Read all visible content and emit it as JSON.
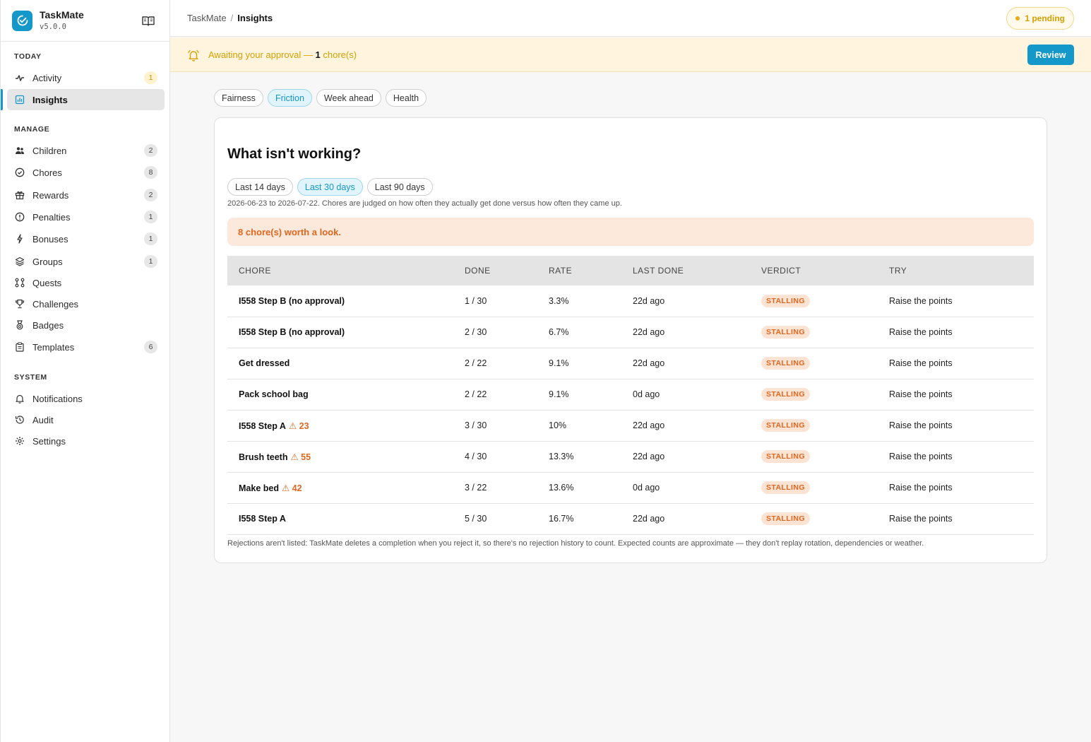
{
  "app": {
    "name": "TaskMate",
    "version": "v5.0.0"
  },
  "sidebar": {
    "sections": [
      {
        "label": "TODAY"
      },
      {
        "label": "MANAGE"
      },
      {
        "label": "SYSTEM"
      }
    ],
    "items": [
      {
        "label": "Activity",
        "badge": "1"
      },
      {
        "label": "Insights"
      },
      {
        "label": "Children",
        "badge": "2"
      },
      {
        "label": "Chores",
        "badge": "8"
      },
      {
        "label": "Rewards",
        "badge": "2"
      },
      {
        "label": "Penalties",
        "badge": "1"
      },
      {
        "label": "Bonuses",
        "badge": "1"
      },
      {
        "label": "Groups",
        "badge": "1"
      },
      {
        "label": "Quests"
      },
      {
        "label": "Challenges"
      },
      {
        "label": "Badges"
      },
      {
        "label": "Templates",
        "badge": "6"
      },
      {
        "label": "Notifications"
      },
      {
        "label": "Audit"
      },
      {
        "label": "Settings"
      }
    ]
  },
  "topbar": {
    "breadcrumb": {
      "root": "TaskMate",
      "separator": "/",
      "current": "Insights"
    },
    "pending": "1 pending"
  },
  "approval": {
    "text": "Awaiting your approval — ",
    "count": "1",
    "suffix": " chore(s)",
    "button": "Review"
  },
  "tabs": [
    "Fairness",
    "Friction",
    "Week ahead",
    "Health"
  ],
  "card": {
    "title": "What isn't working?",
    "ranges": [
      "Last 14 days",
      "Last 30 days",
      "Last 90 days"
    ],
    "range_note": "2026-06-23 to 2026-07-22. Chores are judged on how often they actually get done versus how often they came up.",
    "alert": "8 chore(s) worth a look.",
    "columns": [
      "CHORE",
      "DONE",
      "RATE",
      "LAST DONE",
      "VERDICT",
      "TRY"
    ],
    "rows": [
      {
        "chore": "I558 Step B (no approval)",
        "warn": "",
        "done": "1 / 30",
        "rate": "3.3%",
        "last": "22d ago",
        "verdict": "STALLING",
        "try": "Raise the points"
      },
      {
        "chore": "I558 Step B (no approval)",
        "warn": "",
        "done": "2 / 30",
        "rate": "6.7%",
        "last": "22d ago",
        "verdict": "STALLING",
        "try": "Raise the points"
      },
      {
        "chore": "Get dressed",
        "warn": "",
        "done": "2 / 22",
        "rate": "9.1%",
        "last": "22d ago",
        "verdict": "STALLING",
        "try": "Raise the points"
      },
      {
        "chore": "Pack school bag",
        "warn": "",
        "done": "2 / 22",
        "rate": "9.1%",
        "last": "0d ago",
        "verdict": "STALLING",
        "try": "Raise the points"
      },
      {
        "chore": "I558 Step A",
        "warn": "⚠ 23",
        "done": "3 / 30",
        "rate": "10%",
        "last": "22d ago",
        "verdict": "STALLING",
        "try": "Raise the points"
      },
      {
        "chore": "Brush teeth",
        "warn": "⚠ 55",
        "done": "4 / 30",
        "rate": "13.3%",
        "last": "22d ago",
        "verdict": "STALLING",
        "try": "Raise the points"
      },
      {
        "chore": "Make bed",
        "warn": "⚠ 42",
        "done": "3 / 22",
        "rate": "13.6%",
        "last": "0d ago",
        "verdict": "STALLING",
        "try": "Raise the points"
      },
      {
        "chore": "I558 Step A",
        "warn": "",
        "done": "5 / 30",
        "rate": "16.7%",
        "last": "22d ago",
        "verdict": "STALLING",
        "try": "Raise the points"
      }
    ],
    "footnote": "Rejections aren't listed: TaskMate deletes a completion when you reject it, so there's no rejection history to count. Expected counts are approximate — they don't replay rotation, dependencies or weather."
  },
  "colors": {
    "accent": "#1497c9",
    "warning": "#e0671e",
    "pending": "#d6a000"
  }
}
